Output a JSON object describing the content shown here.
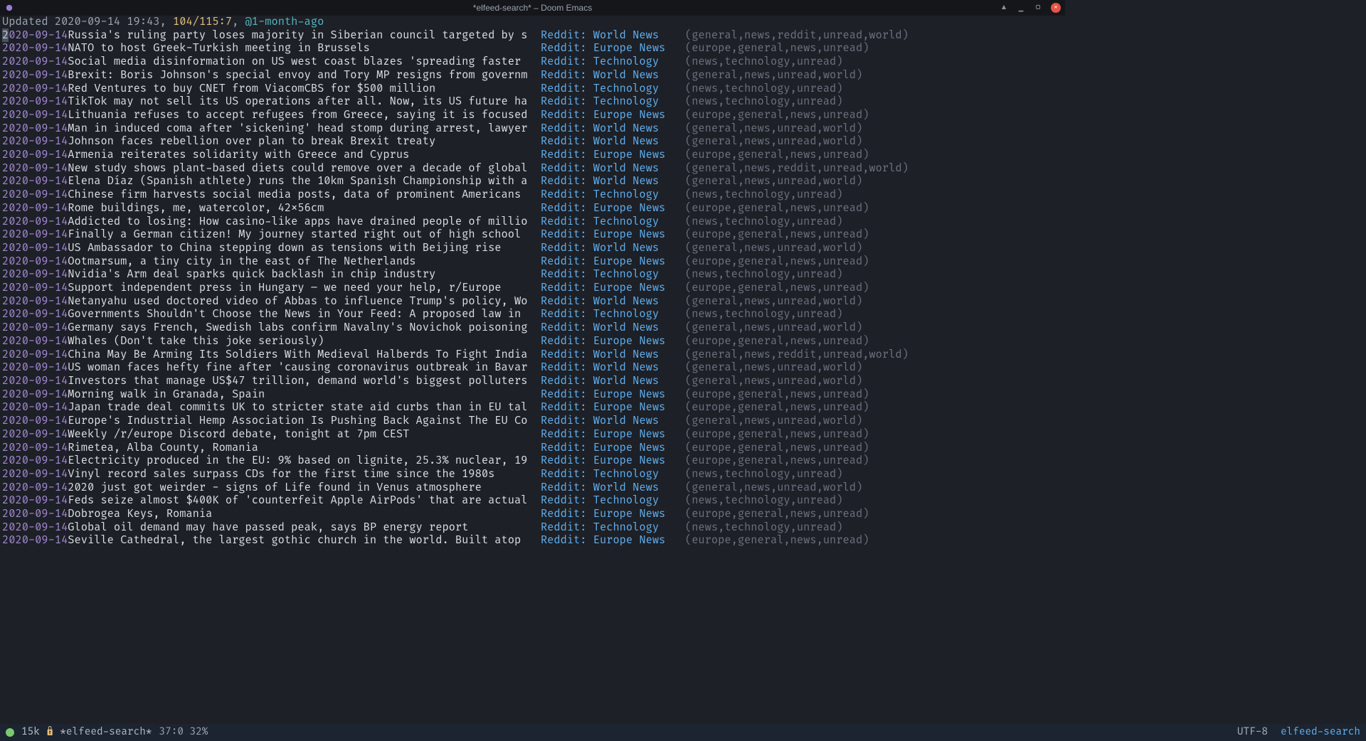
{
  "titlebar": {
    "title": "*elfeed-search* – Doom Emacs",
    "minimize": "▁",
    "maximize": "▢",
    "close": "×",
    "pin": "▲"
  },
  "header": {
    "updated_label": "Updated 2020-09-14 19:43, ",
    "count": "104/115:7",
    "sep": ", ",
    "age": "@1-month-ago"
  },
  "feeds": {
    "world": "Reddit: World News",
    "europe": "Reddit: Europe News",
    "tech": "Reddit: Technology"
  },
  "taglines": {
    "world_r": "(general,news,reddit,unread,world)",
    "world": "(general,news,unread,world)",
    "europe": "(europe,general,news,unread)",
    "tech": "(news,technology,unread)"
  },
  "entries": [
    {
      "date": "2020-09-14",
      "title": "Russia's ruling party loses majority in Siberian council targeted by s",
      "feed": "world",
      "tags": "world_r"
    },
    {
      "date": "2020-09-14",
      "title": "NATO to host Greek-Turkish meeting in Brussels",
      "feed": "europe",
      "tags": "europe"
    },
    {
      "date": "2020-09-14",
      "title": "Social media disinformation on US west coast blazes 'spreading faster ",
      "feed": "tech",
      "tags": "tech"
    },
    {
      "date": "2020-09-14",
      "title": "Brexit: Boris Johnson's special envoy and Tory MP resigns from governm",
      "feed": "world",
      "tags": "world"
    },
    {
      "date": "2020-09-14",
      "title": "Red Ventures to buy CNET from ViacomCBS for $500 million",
      "feed": "tech",
      "tags": "tech"
    },
    {
      "date": "2020-09-14",
      "title": "TikTok may not sell its US operations after all. Now, its US future ha",
      "feed": "tech",
      "tags": "tech"
    },
    {
      "date": "2020-09-14",
      "title": "Lithuania refuses to accept refugees from Greece, saying it is focused",
      "feed": "europe",
      "tags": "europe"
    },
    {
      "date": "2020-09-14",
      "title": "Man in induced coma after 'sickening' head stomp during arrest, lawyer",
      "feed": "world",
      "tags": "world"
    },
    {
      "date": "2020-09-14",
      "title": "Johnson faces rebellion over plan to break Brexit treaty",
      "feed": "world",
      "tags": "world"
    },
    {
      "date": "2020-09-14",
      "title": "Armenia reiterates solidarity with Greece and Cyprus",
      "feed": "europe",
      "tags": "europe"
    },
    {
      "date": "2020-09-14",
      "title": "New study shows plant-based diets could remove over a decade of global",
      "feed": "world",
      "tags": "world_r"
    },
    {
      "date": "2020-09-14",
      "title": "Elena Díaz (Spanish athlete) runs the 10km Spanish Championship with a",
      "feed": "world",
      "tags": "world"
    },
    {
      "date": "2020-09-14",
      "title": "Chinese firm harvests social media posts, data of prominent Americans ",
      "feed": "tech",
      "tags": "tech"
    },
    {
      "date": "2020-09-14",
      "title": "Rome buildings, me, watercolor, 42x56cm",
      "feed": "europe",
      "tags": "europe"
    },
    {
      "date": "2020-09-14",
      "title": "Addicted to losing: How casino-like apps have drained people of millio",
      "feed": "tech",
      "tags": "tech"
    },
    {
      "date": "2020-09-14",
      "title": "Finally a German citizen! My journey started right out of high school ",
      "feed": "europe",
      "tags": "europe"
    },
    {
      "date": "2020-09-14",
      "title": "US Ambassador to China stepping down as tensions with Beijing rise",
      "feed": "world",
      "tags": "world"
    },
    {
      "date": "2020-09-14",
      "title": "Ootmarsum, a tiny city in the east of The Netherlands",
      "feed": "europe",
      "tags": "europe"
    },
    {
      "date": "2020-09-14",
      "title": "Nvidia's Arm deal sparks quick backlash in chip industry",
      "feed": "tech",
      "tags": "tech"
    },
    {
      "date": "2020-09-14",
      "title": "Support independent press in Hungary – we need your help, r/Europe",
      "feed": "europe",
      "tags": "europe"
    },
    {
      "date": "2020-09-14",
      "title": "Netanyahu used doctored video of Abbas to influence Trump's policy, Wo",
      "feed": "world",
      "tags": "world"
    },
    {
      "date": "2020-09-14",
      "title": "Governments Shouldn't Choose the News in Your Feed: A proposed law in ",
      "feed": "tech",
      "tags": "tech"
    },
    {
      "date": "2020-09-14",
      "title": "Germany says French, Swedish labs confirm Navalny's Novichok poisoning",
      "feed": "world",
      "tags": "world"
    },
    {
      "date": "2020-09-14",
      "title": "Whales (Don't take this joke seriously)",
      "feed": "europe",
      "tags": "europe"
    },
    {
      "date": "2020-09-14",
      "title": "China May Be Arming Its Soldiers With Medieval Halberds To Fight India",
      "feed": "world",
      "tags": "world_r"
    },
    {
      "date": "2020-09-14",
      "title": "US woman faces hefty fine after 'causing coronavirus outbreak in Bavar",
      "feed": "world",
      "tags": "world"
    },
    {
      "date": "2020-09-14",
      "title": "Investors that manage US$47 trillion, demand world's biggest polluters",
      "feed": "world",
      "tags": "world"
    },
    {
      "date": "2020-09-14",
      "title": "Morning walk in Granada, Spain",
      "feed": "europe",
      "tags": "europe"
    },
    {
      "date": "2020-09-14",
      "title": "Japan trade deal commits UK to stricter state aid curbs than in EU tal",
      "feed": "europe",
      "tags": "europe"
    },
    {
      "date": "2020-09-14",
      "title": "Europe's Industrial Hemp Association Is Pushing Back Against The EU Co",
      "feed": "world",
      "tags": "world"
    },
    {
      "date": "2020-09-14",
      "title": "Weekly /r/europe Discord debate, tonight at 7pm CEST",
      "feed": "europe",
      "tags": "europe"
    },
    {
      "date": "2020-09-14",
      "title": "Rimetea, Alba County, Romania",
      "feed": "europe",
      "tags": "europe"
    },
    {
      "date": "2020-09-14",
      "title": "Electricity produced in the EU: 9% based on lignite, 25.3% nuclear, 19",
      "feed": "europe",
      "tags": "europe"
    },
    {
      "date": "2020-09-14",
      "title": "Vinyl record sales surpass CDs for the first time since the 1980s",
      "feed": "tech",
      "tags": "tech"
    },
    {
      "date": "2020-09-14",
      "title": "2020 just got weirder - signs of Life found in Venus atmosphere",
      "feed": "world",
      "tags": "world"
    },
    {
      "date": "2020-09-14",
      "title": "Feds seize almost $400K of 'counterfeit Apple AirPods' that are actual",
      "feed": "tech",
      "tags": "tech"
    },
    {
      "date": "2020-09-14",
      "title": "Dobrogea Keys, Romania",
      "feed": "europe",
      "tags": "europe"
    },
    {
      "date": "2020-09-14",
      "title": "Global oil demand may have passed peak, says BP energy report",
      "feed": "tech",
      "tags": "tech"
    },
    {
      "date": "2020-09-14",
      "title": "Seville Cathedral, the largest gothic church in the world. Built atop ",
      "feed": "europe",
      "tags": "europe"
    }
  ],
  "modeline": {
    "size": "15k",
    "lock": "🔒",
    "buffer": "*elfeed-search*",
    "pos": "37:0 32%",
    "encoding": "UTF-8",
    "major": "elfeed-search"
  }
}
